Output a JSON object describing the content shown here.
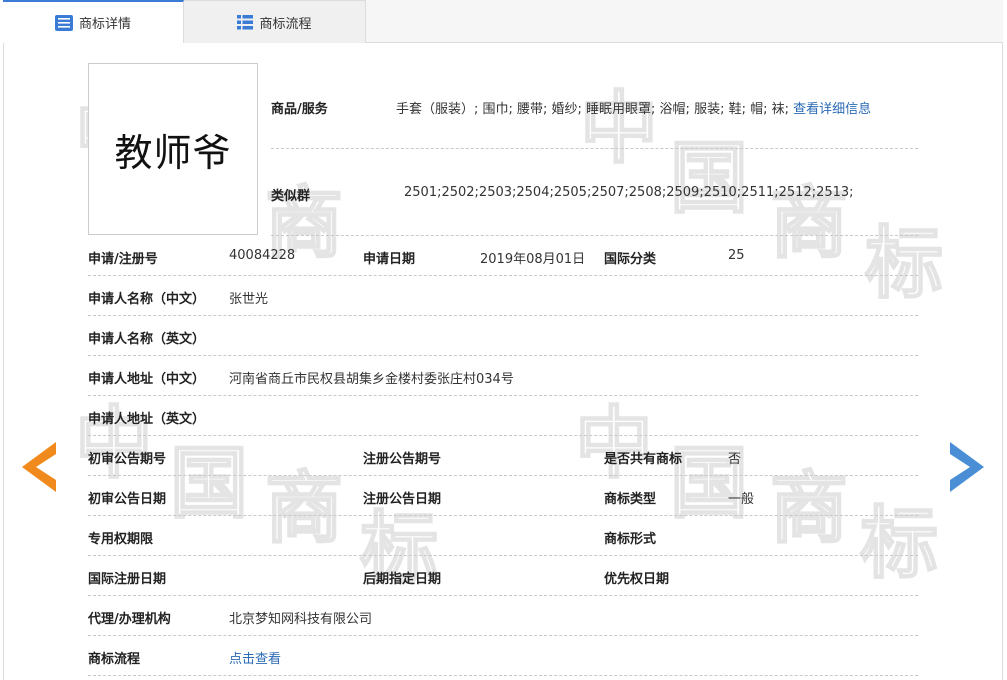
{
  "tabs": [
    {
      "label": "商标详情",
      "icon": "list-icon"
    },
    {
      "label": "商标流程",
      "icon": "grid-list-icon"
    }
  ],
  "watermark": {
    "chars": [
      "中",
      "国",
      "商",
      "标"
    ]
  },
  "trademark": {
    "logo_text": "教师爷"
  },
  "goods": {
    "label": "商品/服务",
    "value": "手套（服装）; 围巾; 腰带; 婚纱; 睡眠用眼罩; 浴帽; 服装; 鞋; 帽; 袜;",
    "link": "查看详细信息"
  },
  "similar": {
    "label": "类似群",
    "value": "2501;2502;2503;2504;2505;2507;2508;2509;2510;2511;2512;2513;"
  },
  "fields": {
    "reg_no_label": "申请/注册号",
    "reg_no": "40084228",
    "apply_date_label": "申请日期",
    "apply_date": "2019年08月01日",
    "intl_class_label": "国际分类",
    "intl_class": "25",
    "applicant_cn_label": "申请人名称（中文）",
    "applicant_cn": "张世光",
    "applicant_en_label": "申请人名称（英文）",
    "applicant_en": "",
    "address_cn_label": "申请人地址（中文）",
    "address_cn": "河南省商丘市民权县胡集乡金楼村委张庄村034号",
    "address_en_label": "申请人地址（英文）",
    "address_en": "",
    "prelim_no_label": "初审公告期号",
    "prelim_no": "",
    "reg_pub_no_label": "注册公告期号",
    "reg_pub_no": "",
    "shared_label": "是否共有商标",
    "shared": "否",
    "prelim_date_label": "初审公告日期",
    "prelim_date": "",
    "reg_pub_date_label": "注册公告日期",
    "reg_pub_date": "",
    "type_label": "商标类型",
    "type": "一般",
    "excl_period_label": "专用权期限",
    "excl_period": "",
    "form_label": "商标形式",
    "form": "",
    "intl_reg_date_label": "国际注册日期",
    "intl_reg_date": "",
    "later_date_label": "后期指定日期",
    "later_date": "",
    "priority_date_label": "优先权日期",
    "priority_date": "",
    "agent_label": "代理/办理机构",
    "agent": "北京梦知网科技有限公司",
    "flow_label": "商标流程",
    "flow_link": "点击查看"
  },
  "colors": {
    "accent": "#3a7bd5",
    "link": "#2a6ab4",
    "prev_arrow": "#f08a1c",
    "next_arrow": "#4a8fd6"
  },
  "nav": {
    "prev_icon": "chevron-left-icon",
    "next_icon": "chevron-right-icon"
  }
}
